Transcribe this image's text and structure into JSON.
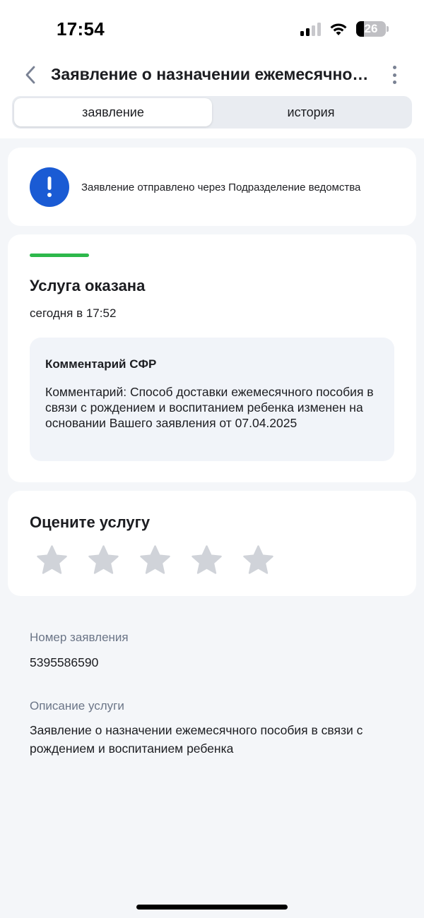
{
  "status_bar": {
    "time": "17:54",
    "battery": "26"
  },
  "header": {
    "title": "Заявление о назначении ежемесячного пособия в связи с рождением и воспитанием ребенка"
  },
  "tabs": [
    {
      "label": "заявление",
      "active": true
    },
    {
      "label": "история",
      "active": false
    }
  ],
  "notice": {
    "text": "Заявление отправлено через Подразделение ведомства",
    "icon": "exclamation-icon",
    "color": "#1a5bd4"
  },
  "status": {
    "progress": 1.0,
    "progress_color": "#2db84b",
    "title": "Услуга оказана",
    "date": "сегодня в 17:52",
    "comment_title": "Комментарий СФР",
    "comment_text": "Комментарий: Способ доставки ежемесячного пособия в связи с рождением и воспитанием ребенка изменен на основании Вашего заявления от 07.04.2025"
  },
  "rating": {
    "title": "Оцените услугу",
    "max": 5,
    "value": 0
  },
  "details": {
    "number_label": "Номер заявления",
    "number_value": "5395586590",
    "description_label": "Описание услуги",
    "description_value": "Заявление о назначении ежемесячного пособия в связи с рождением и воспитанием ребенка"
  }
}
